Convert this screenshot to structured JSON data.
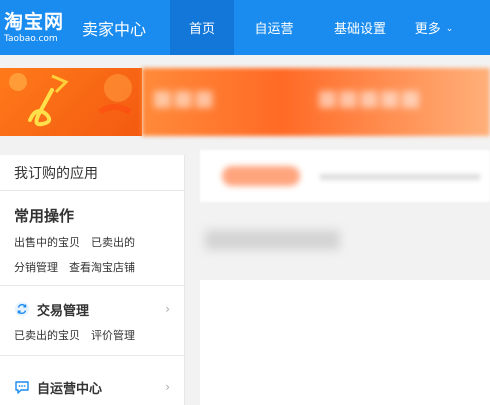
{
  "header": {
    "logo_main": "淘宝网",
    "logo_sub": "Taobao.com",
    "app_title": "卖家中心",
    "nav": [
      {
        "label": "首页",
        "active": true
      },
      {
        "label": "自运营",
        "active": false
      },
      {
        "label": "基础设置",
        "active": false
      },
      {
        "label": "更多",
        "active": false
      }
    ],
    "brand_color": "#1a8cf0",
    "active_color": "#1277d8"
  },
  "sidebar": {
    "title": "我订购的应用",
    "common": {
      "heading": "常用操作",
      "row1": [
        "出售中的宝贝",
        "已卖出的"
      ],
      "row2": [
        "分销管理",
        "查看淘宝店铺"
      ]
    },
    "trade": {
      "heading": "交易管理",
      "icon": "exchange-icon",
      "links": [
        "已卖出的宝贝",
        "评价管理"
      ]
    },
    "self_ops": {
      "heading": "自运营中心",
      "icon": "chat-icon"
    }
  }
}
